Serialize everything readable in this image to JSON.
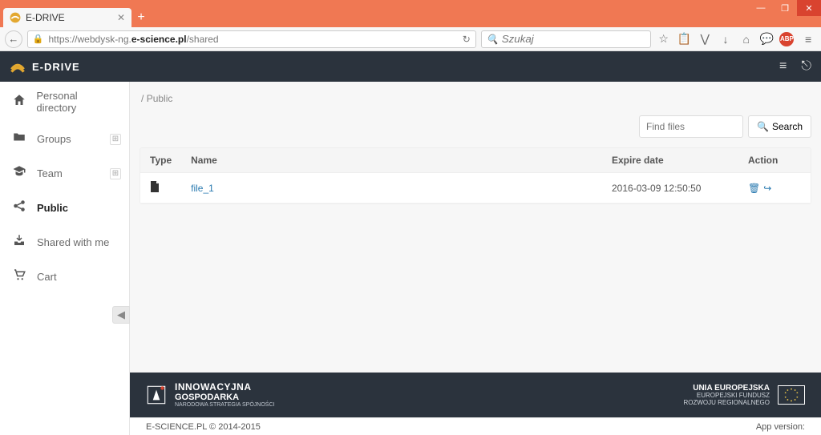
{
  "browser": {
    "tab_title": "E-DRIVE",
    "url_prefix": "https://webdysk-ng.",
    "url_bold": "e-science.pl",
    "url_suffix": "/shared",
    "search_placeholder": "Szukaj"
  },
  "app": {
    "brand": "E-DRIVE"
  },
  "sidebar": {
    "items": [
      {
        "label": "Personal directory",
        "icon": "home",
        "active": false,
        "plus": false
      },
      {
        "label": "Groups",
        "icon": "folder",
        "active": false,
        "plus": true
      },
      {
        "label": "Team",
        "icon": "grad",
        "active": false,
        "plus": true
      },
      {
        "label": "Public",
        "icon": "share",
        "active": true,
        "plus": false
      },
      {
        "label": "Shared with me",
        "icon": "inbox",
        "active": false,
        "plus": false
      },
      {
        "label": "Cart",
        "icon": "cart",
        "active": false,
        "plus": false
      }
    ]
  },
  "breadcrumb": {
    "root": "/",
    "current": "Public"
  },
  "search": {
    "find_placeholder": "Find files",
    "button": "Search"
  },
  "table": {
    "headers": {
      "type": "Type",
      "name": "Name",
      "expire": "Expire date",
      "action": "Action"
    },
    "rows": [
      {
        "name": "file_1",
        "expire": "2016-03-09 12:50:50"
      }
    ]
  },
  "footer_dark": {
    "l1": "INNOWACYJNA",
    "l2": "GOSPODARKA",
    "l3": "NARODOWA STRATEGIA SPÓJNOŚCI",
    "e1": "UNIA EUROPEJSKA",
    "e2": "EUROPEJSKI FUNDUSZ",
    "e3": "ROZWOJU REGIONALNEGO"
  },
  "footer_light": {
    "left": "E-SCIENCE.PL © 2014-2015",
    "right": "App version:"
  }
}
